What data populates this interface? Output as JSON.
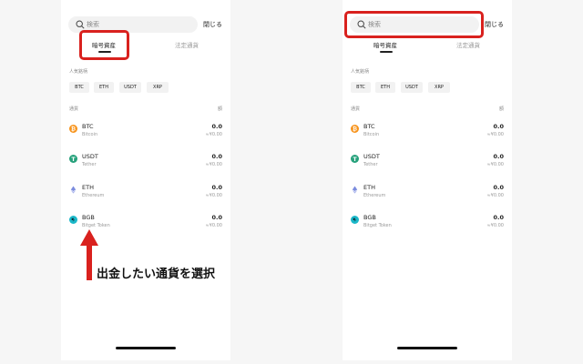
{
  "search": {
    "placeholder": "検索"
  },
  "close_label": "閉じる",
  "tabs": [
    {
      "label": "暗号資産"
    },
    {
      "label": "法定通貨"
    }
  ],
  "popular": {
    "label": "人気銘柄",
    "chips": [
      "BTC",
      "ETH",
      "USDT",
      "XRP"
    ]
  },
  "list": {
    "col_left": "通貨",
    "col_right": "額",
    "coins": [
      {
        "symbol": "BTC",
        "name": "Bitcoin",
        "balance": "0.0",
        "fiat": "≈¥0.00",
        "color": "#f7931a"
      },
      {
        "symbol": "USDT",
        "name": "Tether",
        "balance": "0.0",
        "fiat": "≈¥0.00",
        "color": "#26a17b"
      },
      {
        "symbol": "ETH",
        "name": "Ethereum",
        "balance": "0.0",
        "fiat": "≈¥0.00",
        "color": "#7b8cde"
      },
      {
        "symbol": "BGB",
        "name": "Bitget Token",
        "balance": "0.0",
        "fiat": "≈¥0.00",
        "color": "#1bb8c9"
      }
    ]
  },
  "annotation": {
    "instruction": "出金したい通貨を選択",
    "highlight_color": "#d9211e"
  }
}
